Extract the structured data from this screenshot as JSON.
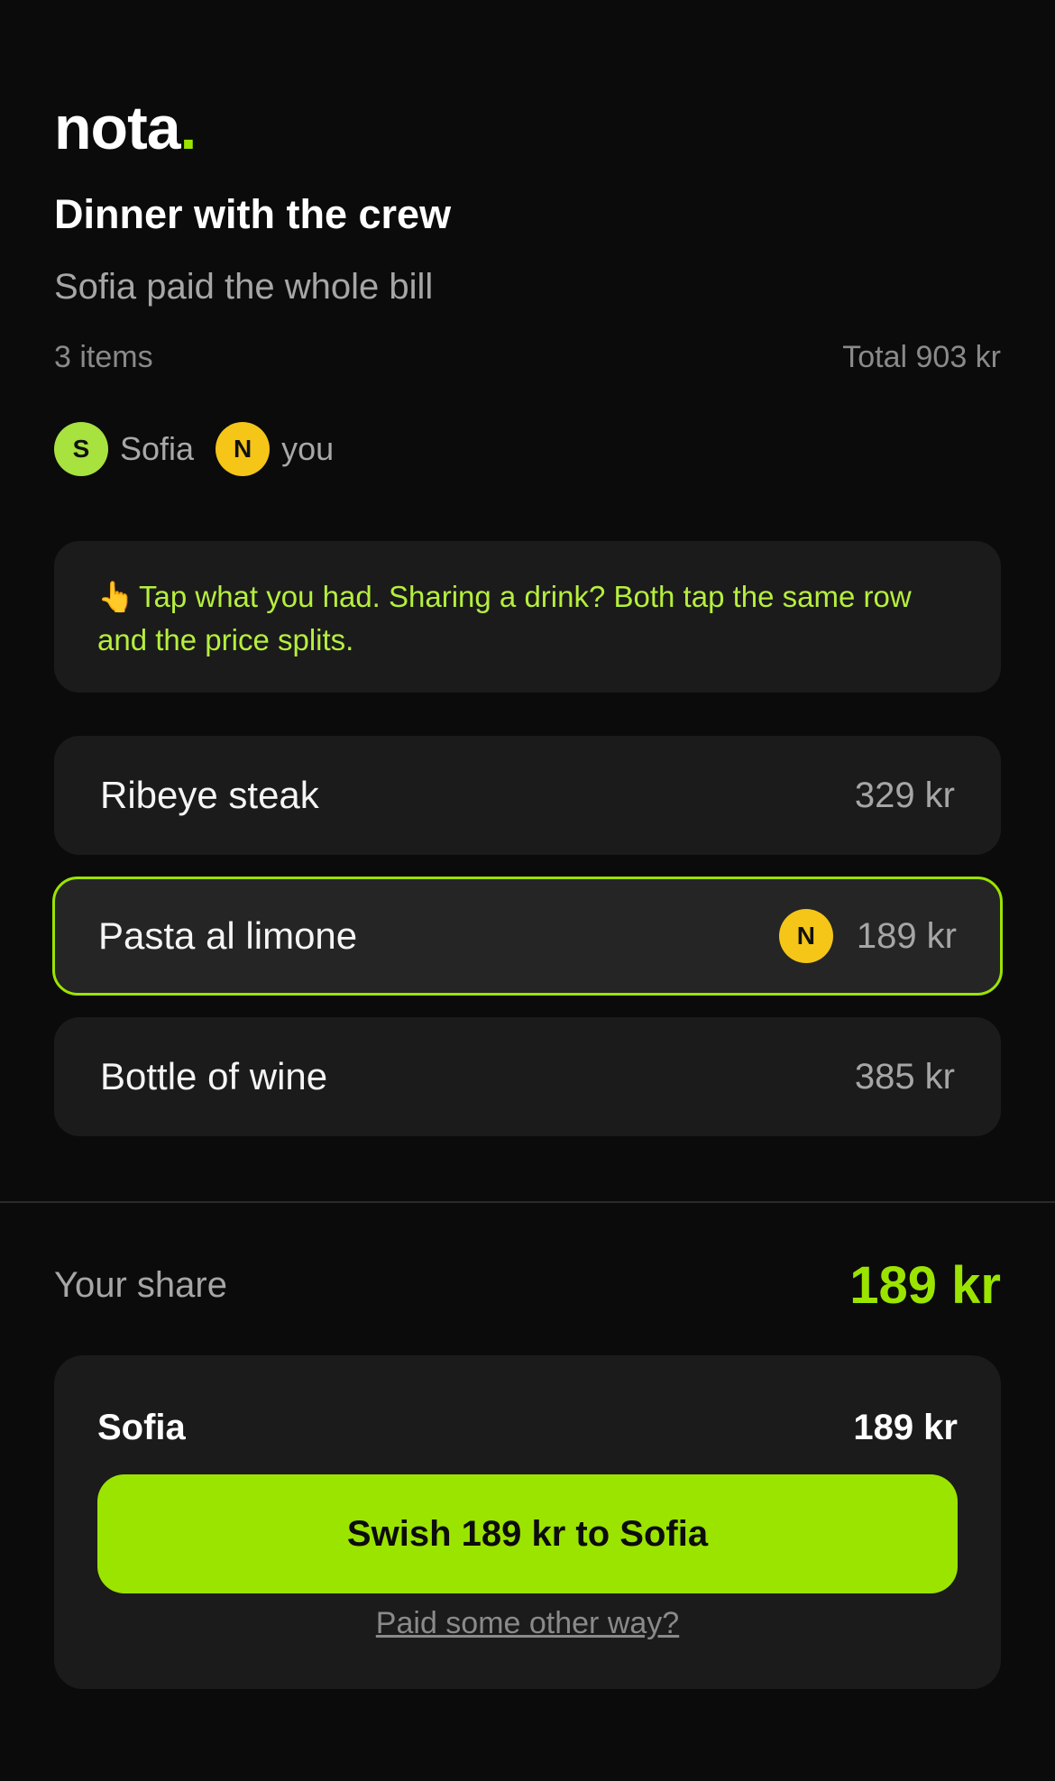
{
  "app": {
    "logo_text": "nota",
    "logo_dot": ".",
    "accent_color": "#9be400"
  },
  "bill": {
    "title": "Dinner with the crew",
    "subtitle": "Sofia paid the whole bill",
    "item_count": "3 items",
    "total": "Total 903 kr"
  },
  "people": [
    {
      "initial": "S",
      "name": "Sofia",
      "color": "#a7e23f"
    },
    {
      "initial": "N",
      "name": "you",
      "color": "#f5c518"
    }
  ],
  "hint": {
    "icon": "pointing-hand-icon",
    "glyph": "👆",
    "text": "Tap what you had. Sharing a drink? Both tap the same row and the price splits."
  },
  "items": [
    {
      "name": "Ribeye steak",
      "price": "329 kr",
      "selected": false
    },
    {
      "name": "Pasta al limone",
      "price": "189 kr",
      "selected": true,
      "claimed_by": "N"
    },
    {
      "name": "Bottle of wine",
      "price": "385 kr",
      "selected": false
    }
  ],
  "share": {
    "label": "Your share",
    "amount": "189 kr"
  },
  "payment": {
    "recipient": "Sofia",
    "amount": "189 kr",
    "button_label": "Swish 189 kr to Sofia",
    "alt_link": "Paid some other way?"
  }
}
